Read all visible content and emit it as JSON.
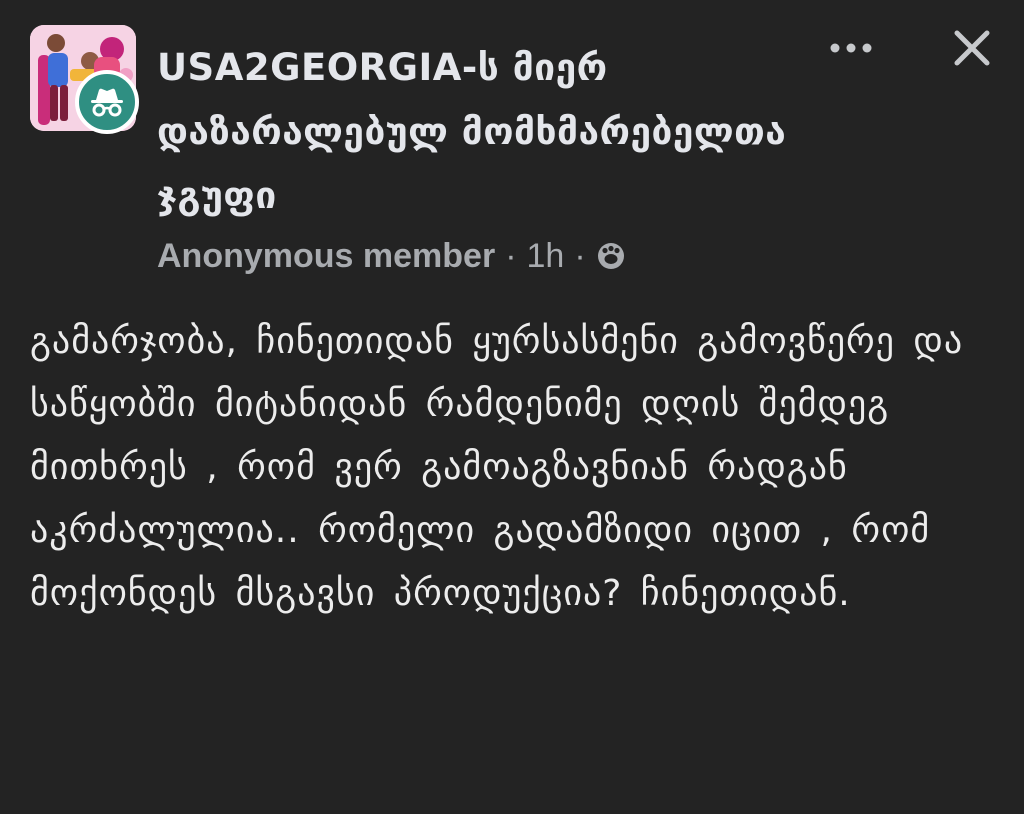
{
  "post": {
    "group_name": "USA2GEORGIA-ს მიერ დაზარალებულ მომხმარებელთა ჯგუფი",
    "author": "Anonymous member",
    "separator": "·",
    "time": "1h",
    "audience_icon": "anonymous-audience-icon",
    "body": "გამარჯობა, ჩინეთიდან ყურსასმენი გამოვწერე და საწყობში მიტანიდან რამდენიმე დღის შემდეგ მითხრეს , რომ ვერ გამოაგზავნიან რადგან აკრძალულია.. რომელი გადამზიდი იცით , რომ მოქონდეს მსგავსი პროდუქცია? ჩინეთიდან."
  },
  "icons": {
    "more": "more-horizontal-icon",
    "close": "close-icon",
    "avatar_badge": "incognito-icon"
  },
  "colors": {
    "background": "#232323",
    "primary_text": "#e4e6eb",
    "secondary_text": "#a8abaf",
    "badge": "#2f8f82"
  }
}
